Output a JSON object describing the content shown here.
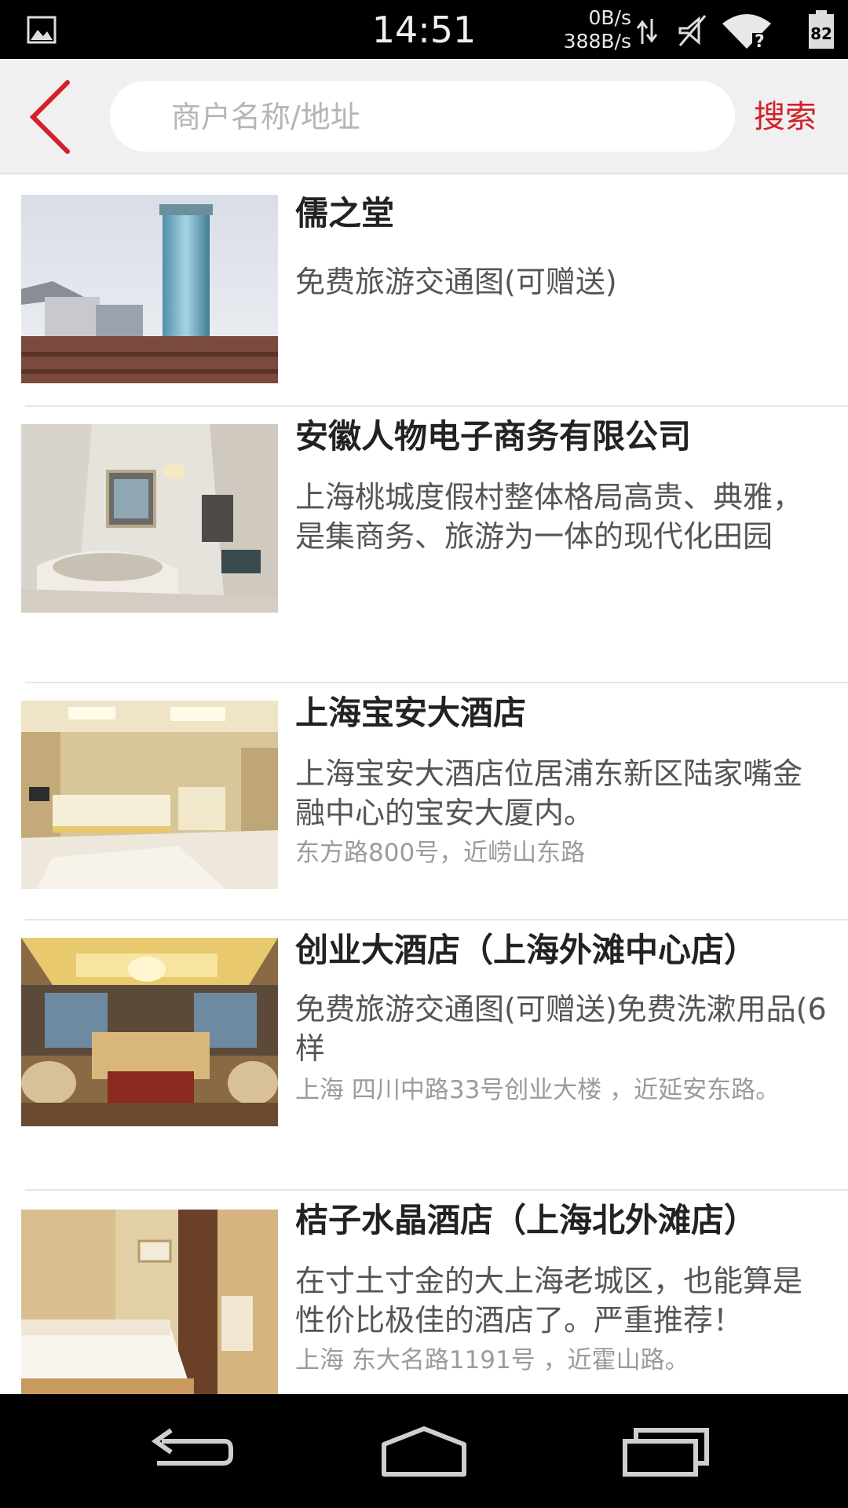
{
  "status_bar": {
    "time": "14:51",
    "net_down": "0B/s",
    "net_up": "388B/s",
    "battery": "82",
    "icons": [
      "gallery-icon",
      "data-arrows-icon",
      "mute-icon",
      "wifi-icon",
      "battery-icon"
    ]
  },
  "header": {
    "back_icon": "chevron-left-icon",
    "search_placeholder": "商户名称/地址",
    "search_value": "",
    "search_button": "搜索",
    "accent_color": "#d3202a"
  },
  "list": {
    "items": [
      {
        "title": "儒之堂",
        "description": "免费旅游交通图(可赠送)",
        "address": "",
        "image": "hotel-tower-photo"
      },
      {
        "title": "安徽人物电子商务有限公司",
        "description": "上海桃城度假村整体格局高贵、典雅，是集商务、旅游为一体的现代化田园",
        "address": "",
        "image": "marble-bathroom-photo"
      },
      {
        "title": "上海宝安大酒店",
        "description": "上海宝安大酒店位居浦东新区陆家嘴金融中心的宝安大厦内。",
        "address": "东方路800号，近崂山东路",
        "image": "hotel-lobby-photo"
      },
      {
        "title": "创业大酒店（上海外滩中心店）",
        "description": "免费旅游交通图(可赠送)免费洗漱用品(6样",
        "address": "上海 四川中路33号创业大楼 ，近延安东路。",
        "image": "hotel-lounge-photo"
      },
      {
        "title": "桔子水晶酒店（上海北外滩店）",
        "description": "在寸土寸金的大上海老城区，也能算是性价比极佳的酒店了。严重推荐！",
        "address": "上海 东大名路1191号 ，近霍山路。",
        "image": "hotel-bedroom-photo"
      }
    ]
  },
  "nav_bar": {
    "icons": [
      "back-nav-icon",
      "home-nav-icon",
      "recents-nav-icon"
    ]
  }
}
